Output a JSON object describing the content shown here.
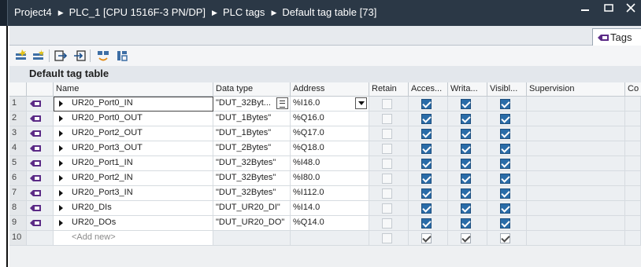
{
  "breadcrumb": [
    "Project4",
    "PLC_1 [CPU 1516F-3 PN/DP]",
    "PLC tags",
    "Default tag table [73]"
  ],
  "tab": {
    "label": "Tags"
  },
  "table_title": "Default tag table",
  "columns": [
    "",
    "",
    "Name",
    "Data type",
    "Address",
    "Retain",
    "Acces...",
    "Writa...",
    "Visibl...",
    "Supervision",
    "Co"
  ],
  "rows": [
    {
      "num": "1",
      "name": "UR20_Port0_IN",
      "type": "\"DUT_32Byt...",
      "address": "%I16.0",
      "retain": false,
      "access": true,
      "write": true,
      "visible": true
    },
    {
      "num": "2",
      "name": "UR20_Port0_OUT",
      "type": "\"DUT_1Bytes\"",
      "address": "%Q16.0",
      "retain": false,
      "access": true,
      "write": true,
      "visible": true
    },
    {
      "num": "3",
      "name": "UR20_Port2_OUT",
      "type": "\"DUT_1Bytes\"",
      "address": "%Q17.0",
      "retain": false,
      "access": true,
      "write": true,
      "visible": true
    },
    {
      "num": "4",
      "name": "UR20_Port3_OUT",
      "type": "\"DUT_2Bytes\"",
      "address": "%Q18.0",
      "retain": false,
      "access": true,
      "write": true,
      "visible": true
    },
    {
      "num": "5",
      "name": "UR20_Port1_IN",
      "type": "\"DUT_32Bytes\"",
      "address": "%I48.0",
      "retain": false,
      "access": true,
      "write": true,
      "visible": true
    },
    {
      "num": "6",
      "name": "UR20_Port2_IN",
      "type": "\"DUT_32Bytes\"",
      "address": "%I80.0",
      "retain": false,
      "access": true,
      "write": true,
      "visible": true
    },
    {
      "num": "7",
      "name": "UR20_Port3_IN",
      "type": "\"DUT_32Bytes\"",
      "address": "%I112.0",
      "retain": false,
      "access": true,
      "write": true,
      "visible": true
    },
    {
      "num": "8",
      "name": "UR20_DIs",
      "type": "\"DUT_UR20_DI\"",
      "address": "%I14.0",
      "retain": false,
      "access": true,
      "write": true,
      "visible": true
    },
    {
      "num": "9",
      "name": "UR20_DOs",
      "type": "\"DUT_UR20_DO\"",
      "address": "%Q14.0",
      "retain": false,
      "access": true,
      "write": true,
      "visible": true
    }
  ],
  "add_new": {
    "num": "10",
    "label": "<Add new>"
  },
  "colors": {
    "titlebar": "#2b3846",
    "checkbox": "#2a6ca8",
    "tag_icon": "#5b2a86"
  },
  "icons": [
    "insert-row-icon",
    "add-row-icon",
    "export-icon",
    "import-icon",
    "monitor-icon",
    "settings-icon",
    "tag-icon",
    "expand-arrow-icon"
  ]
}
